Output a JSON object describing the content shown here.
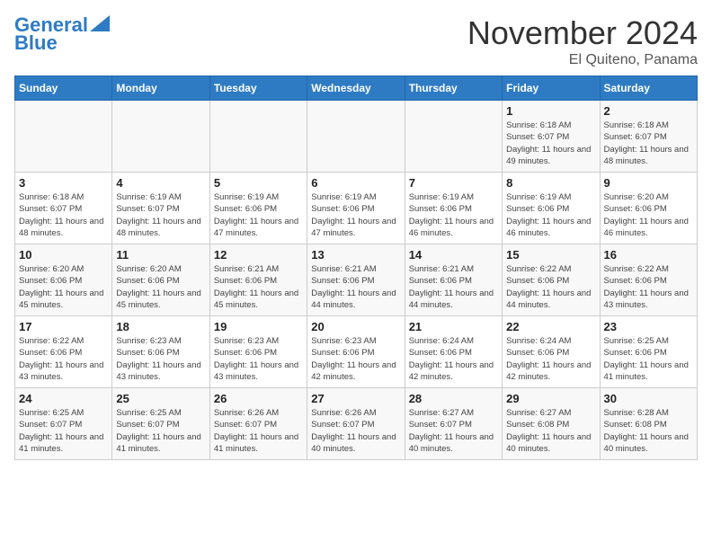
{
  "header": {
    "logo_line1": "General",
    "logo_line2": "Blue",
    "month": "November 2024",
    "location": "El Quiteno, Panama"
  },
  "days_of_week": [
    "Sunday",
    "Monday",
    "Tuesday",
    "Wednesday",
    "Thursday",
    "Friday",
    "Saturday"
  ],
  "weeks": [
    [
      {
        "day": "",
        "info": ""
      },
      {
        "day": "",
        "info": ""
      },
      {
        "day": "",
        "info": ""
      },
      {
        "day": "",
        "info": ""
      },
      {
        "day": "",
        "info": ""
      },
      {
        "day": "1",
        "info": "Sunrise: 6:18 AM\nSunset: 6:07 PM\nDaylight: 11 hours and 49 minutes."
      },
      {
        "day": "2",
        "info": "Sunrise: 6:18 AM\nSunset: 6:07 PM\nDaylight: 11 hours and 48 minutes."
      }
    ],
    [
      {
        "day": "3",
        "info": "Sunrise: 6:18 AM\nSunset: 6:07 PM\nDaylight: 11 hours and 48 minutes."
      },
      {
        "day": "4",
        "info": "Sunrise: 6:19 AM\nSunset: 6:07 PM\nDaylight: 11 hours and 48 minutes."
      },
      {
        "day": "5",
        "info": "Sunrise: 6:19 AM\nSunset: 6:06 PM\nDaylight: 11 hours and 47 minutes."
      },
      {
        "day": "6",
        "info": "Sunrise: 6:19 AM\nSunset: 6:06 PM\nDaylight: 11 hours and 47 minutes."
      },
      {
        "day": "7",
        "info": "Sunrise: 6:19 AM\nSunset: 6:06 PM\nDaylight: 11 hours and 46 minutes."
      },
      {
        "day": "8",
        "info": "Sunrise: 6:19 AM\nSunset: 6:06 PM\nDaylight: 11 hours and 46 minutes."
      },
      {
        "day": "9",
        "info": "Sunrise: 6:20 AM\nSunset: 6:06 PM\nDaylight: 11 hours and 46 minutes."
      }
    ],
    [
      {
        "day": "10",
        "info": "Sunrise: 6:20 AM\nSunset: 6:06 PM\nDaylight: 11 hours and 45 minutes."
      },
      {
        "day": "11",
        "info": "Sunrise: 6:20 AM\nSunset: 6:06 PM\nDaylight: 11 hours and 45 minutes."
      },
      {
        "day": "12",
        "info": "Sunrise: 6:21 AM\nSunset: 6:06 PM\nDaylight: 11 hours and 45 minutes."
      },
      {
        "day": "13",
        "info": "Sunrise: 6:21 AM\nSunset: 6:06 PM\nDaylight: 11 hours and 44 minutes."
      },
      {
        "day": "14",
        "info": "Sunrise: 6:21 AM\nSunset: 6:06 PM\nDaylight: 11 hours and 44 minutes."
      },
      {
        "day": "15",
        "info": "Sunrise: 6:22 AM\nSunset: 6:06 PM\nDaylight: 11 hours and 44 minutes."
      },
      {
        "day": "16",
        "info": "Sunrise: 6:22 AM\nSunset: 6:06 PM\nDaylight: 11 hours and 43 minutes."
      }
    ],
    [
      {
        "day": "17",
        "info": "Sunrise: 6:22 AM\nSunset: 6:06 PM\nDaylight: 11 hours and 43 minutes."
      },
      {
        "day": "18",
        "info": "Sunrise: 6:23 AM\nSunset: 6:06 PM\nDaylight: 11 hours and 43 minutes."
      },
      {
        "day": "19",
        "info": "Sunrise: 6:23 AM\nSunset: 6:06 PM\nDaylight: 11 hours and 43 minutes."
      },
      {
        "day": "20",
        "info": "Sunrise: 6:23 AM\nSunset: 6:06 PM\nDaylight: 11 hours and 42 minutes."
      },
      {
        "day": "21",
        "info": "Sunrise: 6:24 AM\nSunset: 6:06 PM\nDaylight: 11 hours and 42 minutes."
      },
      {
        "day": "22",
        "info": "Sunrise: 6:24 AM\nSunset: 6:06 PM\nDaylight: 11 hours and 42 minutes."
      },
      {
        "day": "23",
        "info": "Sunrise: 6:25 AM\nSunset: 6:06 PM\nDaylight: 11 hours and 41 minutes."
      }
    ],
    [
      {
        "day": "24",
        "info": "Sunrise: 6:25 AM\nSunset: 6:07 PM\nDaylight: 11 hours and 41 minutes."
      },
      {
        "day": "25",
        "info": "Sunrise: 6:25 AM\nSunset: 6:07 PM\nDaylight: 11 hours and 41 minutes."
      },
      {
        "day": "26",
        "info": "Sunrise: 6:26 AM\nSunset: 6:07 PM\nDaylight: 11 hours and 41 minutes."
      },
      {
        "day": "27",
        "info": "Sunrise: 6:26 AM\nSunset: 6:07 PM\nDaylight: 11 hours and 40 minutes."
      },
      {
        "day": "28",
        "info": "Sunrise: 6:27 AM\nSunset: 6:07 PM\nDaylight: 11 hours and 40 minutes."
      },
      {
        "day": "29",
        "info": "Sunrise: 6:27 AM\nSunset: 6:08 PM\nDaylight: 11 hours and 40 minutes."
      },
      {
        "day": "30",
        "info": "Sunrise: 6:28 AM\nSunset: 6:08 PM\nDaylight: 11 hours and 40 minutes."
      }
    ]
  ]
}
